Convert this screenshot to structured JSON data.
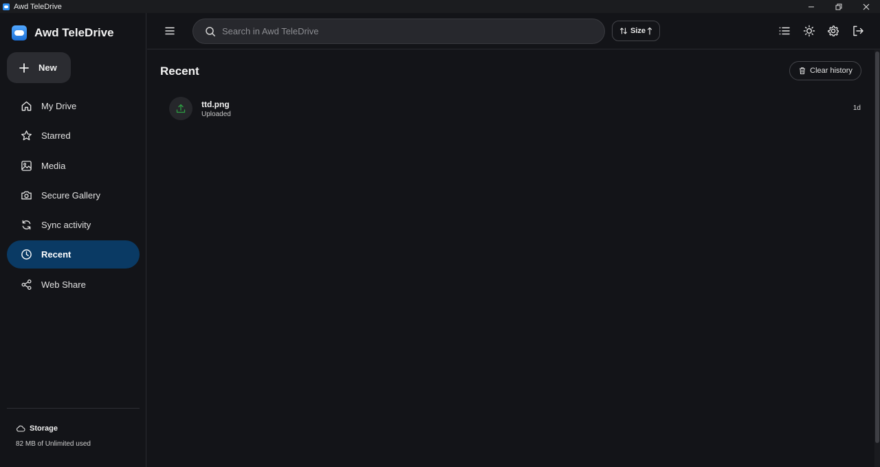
{
  "window": {
    "title": "Awd TeleDrive",
    "controls": [
      "minimize-icon",
      "restore-icon",
      "close-icon"
    ]
  },
  "sidebar": {
    "brand": "Awd TeleDrive",
    "new_label": "New",
    "items": [
      {
        "label": "My Drive",
        "icon": "home-icon"
      },
      {
        "label": "Starred",
        "icon": "star-icon"
      },
      {
        "label": "Media",
        "icon": "image-icon"
      },
      {
        "label": "Secure Gallery",
        "icon": "camera-icon"
      },
      {
        "label": "Sync activity",
        "icon": "sync-icon"
      },
      {
        "label": "Recent",
        "icon": "clock-icon",
        "active": true
      },
      {
        "label": "Web Share",
        "icon": "share-icon"
      }
    ],
    "storage": {
      "title": "Storage",
      "used": "82 MB of Unlimited used"
    }
  },
  "topbar": {
    "search_placeholder": "Search in Awd TeleDrive",
    "sort_label": "Size",
    "icons": [
      "list-view-icon",
      "theme-toggle-icon",
      "settings-icon",
      "logout-icon"
    ]
  },
  "main": {
    "title": "Recent",
    "clear_label": "Clear history",
    "items": [
      {
        "name": "ttd.png",
        "status": "Uploaded",
        "time": "1d",
        "icon": "upload-icon"
      }
    ]
  },
  "colors": {
    "background": "#131418",
    "active_nav": "#0a3a64",
    "accent_green": "#2ea043"
  }
}
